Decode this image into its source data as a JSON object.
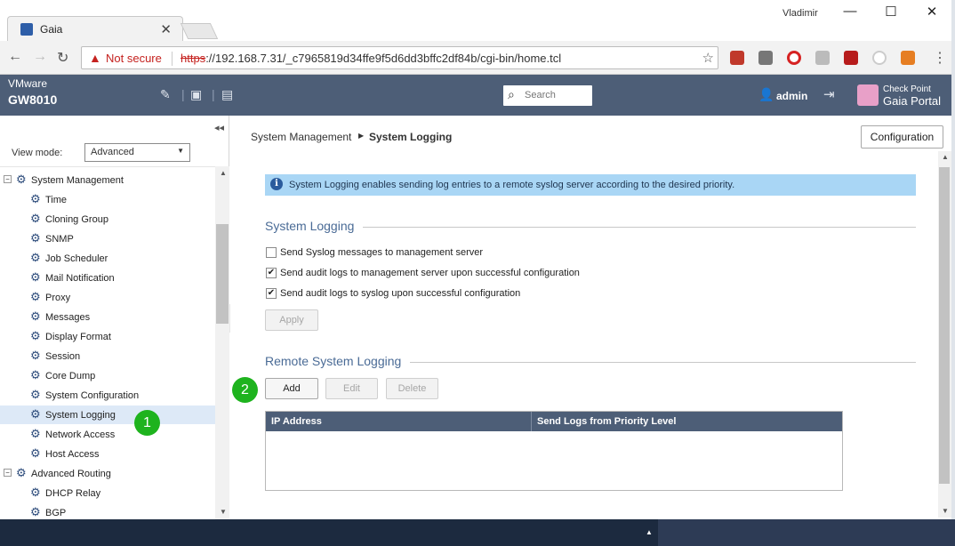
{
  "browser": {
    "tab_title": "Gaia",
    "tab_close": "✕",
    "user": "Vladimir",
    "win_minimize": "—",
    "win_maximize": "☐",
    "win_close": "✕",
    "not_secure": "Not secure",
    "url_scheme": "https",
    "url_rest": "://192.168.7.31/_c7965819d34ffe9f5d6dd3bffc2df84b/cgi-bin/home.tcl",
    "star_icon": "☆"
  },
  "header": {
    "vendor": "VMware",
    "hostname": "GW8010",
    "search_placeholder": "Search",
    "user": "admin",
    "brand_line1": "Check Point",
    "brand_line2": "Gaia Portal"
  },
  "sidebar": {
    "view_mode_label": "View mode:",
    "view_mode_value": "Advanced",
    "tree": [
      {
        "label": "System Management",
        "level": 0,
        "toggle": "−",
        "icon": "gear-icon"
      },
      {
        "label": "Time",
        "level": 1,
        "icon": "gear-icon"
      },
      {
        "label": "Cloning Group",
        "level": 1,
        "icon": "gear-icon"
      },
      {
        "label": "SNMP",
        "level": 1,
        "icon": "gear-icon"
      },
      {
        "label": "Job Scheduler",
        "level": 1,
        "icon": "gear-icon"
      },
      {
        "label": "Mail Notification",
        "level": 1,
        "icon": "gear-icon"
      },
      {
        "label": "Proxy",
        "level": 1,
        "icon": "gear-icon"
      },
      {
        "label": "Messages",
        "level": 1,
        "icon": "gear-icon"
      },
      {
        "label": "Display Format",
        "level": 1,
        "icon": "gear-icon"
      },
      {
        "label": "Session",
        "level": 1,
        "icon": "gear-icon"
      },
      {
        "label": "Core Dump",
        "level": 1,
        "icon": "gear-icon"
      },
      {
        "label": "System Configuration",
        "level": 1,
        "icon": "gear-icon"
      },
      {
        "label": "System Logging",
        "level": 1,
        "icon": "gear-icon",
        "selected": true
      },
      {
        "label": "Network Access",
        "level": 1,
        "icon": "gear-icon"
      },
      {
        "label": "Host Access",
        "level": 1,
        "icon": "gear-icon"
      },
      {
        "label": "Advanced Routing",
        "level": 0,
        "toggle": "−",
        "icon": "routing-icon"
      },
      {
        "label": "DHCP Relay",
        "level": 1,
        "icon": "routing-icon"
      },
      {
        "label": "BGP",
        "level": 1,
        "icon": "routing-icon"
      }
    ],
    "badge": "1"
  },
  "main": {
    "breadcrumb_parent": "System Management",
    "breadcrumb_current": "System Logging",
    "config_button": "Configuration",
    "info_text": "System Logging enables sending log entries to a remote syslog server according to the desired priority.",
    "section1_title": "System Logging",
    "checkboxes": [
      {
        "label": "Send Syslog messages to management server",
        "checked": false
      },
      {
        "label": "Send audit logs to management server upon successful configuration",
        "checked": true
      },
      {
        "label": "Send audit logs to syslog upon successful configuration",
        "checked": true
      }
    ],
    "apply_button": "Apply",
    "section2_title": "Remote System Logging",
    "add_button": "Add",
    "edit_button": "Edit",
    "delete_button": "Delete",
    "badge": "2",
    "table_headers": [
      "IP Address",
      "Send Logs from Priority Level"
    ]
  },
  "colors": {
    "header_bg": "#4d5e77",
    "info_bg": "#a9d6f5",
    "section_title": "#4a6b96",
    "badge": "#1eb31e",
    "selection": "#dde9f7"
  }
}
